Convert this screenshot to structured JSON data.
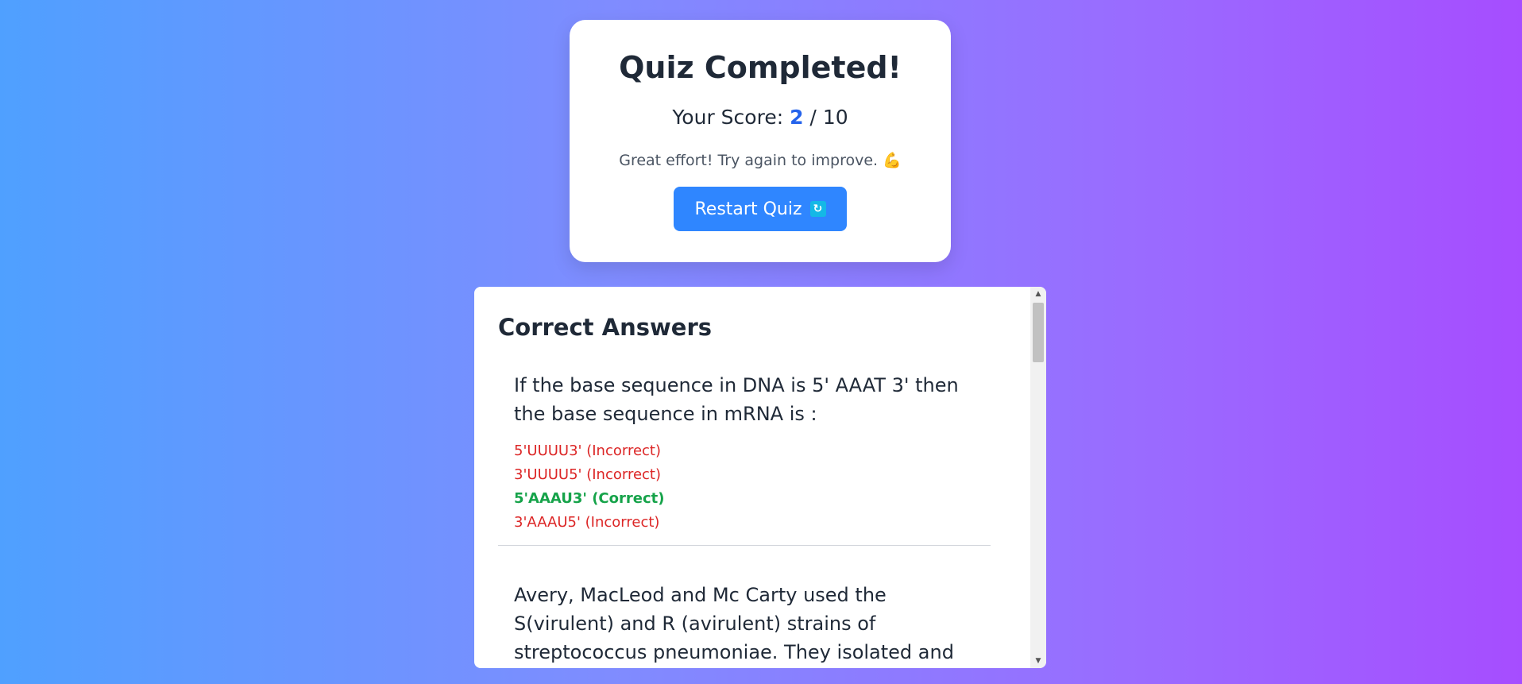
{
  "result": {
    "title": "Quiz Completed!",
    "score_prefix": "Your Score: ",
    "score": "2",
    "score_separator": " / ",
    "total": "10",
    "message": "Great effort! Try again to improve. 💪",
    "restart_label": "Restart Quiz",
    "restart_icon": "🔄"
  },
  "answers": {
    "title": "Correct Answers",
    "questions": [
      {
        "text": "If the base sequence in DNA is 5' AAAT 3' then the base sequence in mRNA is :",
        "options": [
          {
            "text": "5'UUUU3' (Incorrect)",
            "status": "incorrect"
          },
          {
            "text": "3'UUUU5' (Incorrect)",
            "status": "incorrect"
          },
          {
            "text": "5'AAAU3' (Correct)",
            "status": "correct"
          },
          {
            "text": "3'AAAU5' (Incorrect)",
            "status": "incorrect"
          }
        ]
      },
      {
        "text": "Avery, MacLeod and Mc Carty used the S(virulent) and R (avirulent) strains of streptococcus pneumoniae. They isolated and purified protein,"
      }
    ]
  },
  "colors": {
    "correct": "#16a34a",
    "incorrect": "#dc2626",
    "accent": "#2f86ff",
    "score": "#2563eb"
  }
}
